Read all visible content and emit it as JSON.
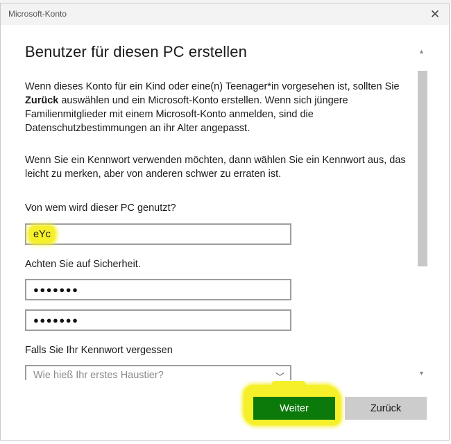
{
  "window": {
    "title": "Microsoft-Konto",
    "close_icon": "close-icon"
  },
  "content": {
    "heading": "Benutzer für diesen PC erstellen",
    "paragraph1_before": "Wenn dieses Konto für ein Kind oder eine(n) Teenager*in vorgesehen ist, sollten Sie ",
    "paragraph1_bold": "Zurück",
    "paragraph1_after": " auswählen und ein Microsoft-Konto erstellen. Wenn sich jüngere Familienmitglieder mit einem Microsoft-Konto anmelden, sind die Datenschutzbestimmungen an ihr Alter angepasst.",
    "paragraph2": "Wenn Sie ein Kennwort verwenden möchten, dann wählen Sie ein Kennwort aus, das leicht zu merken, aber von anderen schwer zu erraten ist.",
    "username_label": "Von wem wird dieser PC genutzt?",
    "username_value": "eYc",
    "security_label": "Achten Sie auf Sicherheit.",
    "password_value": "●●●●●●●",
    "password_confirm_value": "●●●●●●●",
    "forgot_label": "Falls Sie Ihr Kennwort vergessen",
    "security_question_placeholder": "Wie hieß Ihr erstes Haustier?"
  },
  "buttons": {
    "next_label": "Weiter",
    "back_label": "Zurück"
  },
  "colors": {
    "next_button": "#0b7a0b",
    "back_button": "#cccccc",
    "highlight": "#f5f02a"
  }
}
